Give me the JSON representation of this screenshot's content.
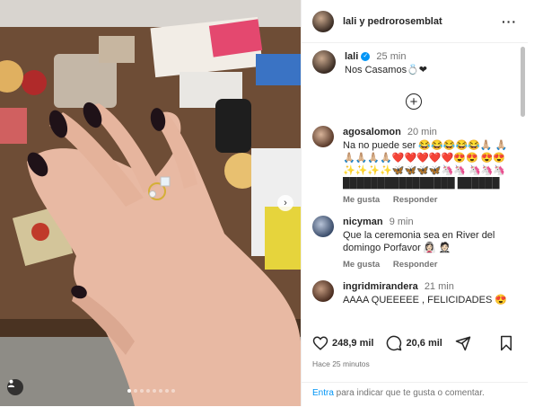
{
  "post": {
    "header_names": "lali y pedrorosemblat"
  },
  "caption": {
    "username": "lali",
    "time": "25 min",
    "text": "Nos Casamos💍❤"
  },
  "comments": [
    {
      "username": "agosalomon",
      "time": "20 min",
      "text": "Na no puede ser 😂😂😂😂😂🙏🏼 🙏🏼🙏🏼🙏🏼🙏🏼🙏🏼❤️❤️❤️❤️❤️😍😍 😍😍✨✨✨✨🦋🦋🦋🦋🦄🦄 🦄🦄🦄████████████████ ██████",
      "like_label": "Me gusta",
      "reply_label": "Responder"
    },
    {
      "username": "nicyman",
      "time": "9 min",
      "text": "Que la ceremonia sea en River del domingo Porfavor 👰🏻‍♀️ 🤵🏻",
      "like_label": "Me gusta",
      "reply_label": "Responder"
    },
    {
      "username": "ingridmirandera",
      "time": "21 min",
      "text": "AAAA QUEEEEE , FELICIDADES 😍"
    }
  ],
  "actions": {
    "likes": "248,9 mil",
    "comments": "20,6 mil"
  },
  "posted_ago": "Hace 25 minutos",
  "login": {
    "link": "Entra",
    "text": " para indicar que te gusta o comentar."
  },
  "colors": {
    "link": "#0095f6",
    "muted": "#737373",
    "nail": "#1f1218"
  }
}
